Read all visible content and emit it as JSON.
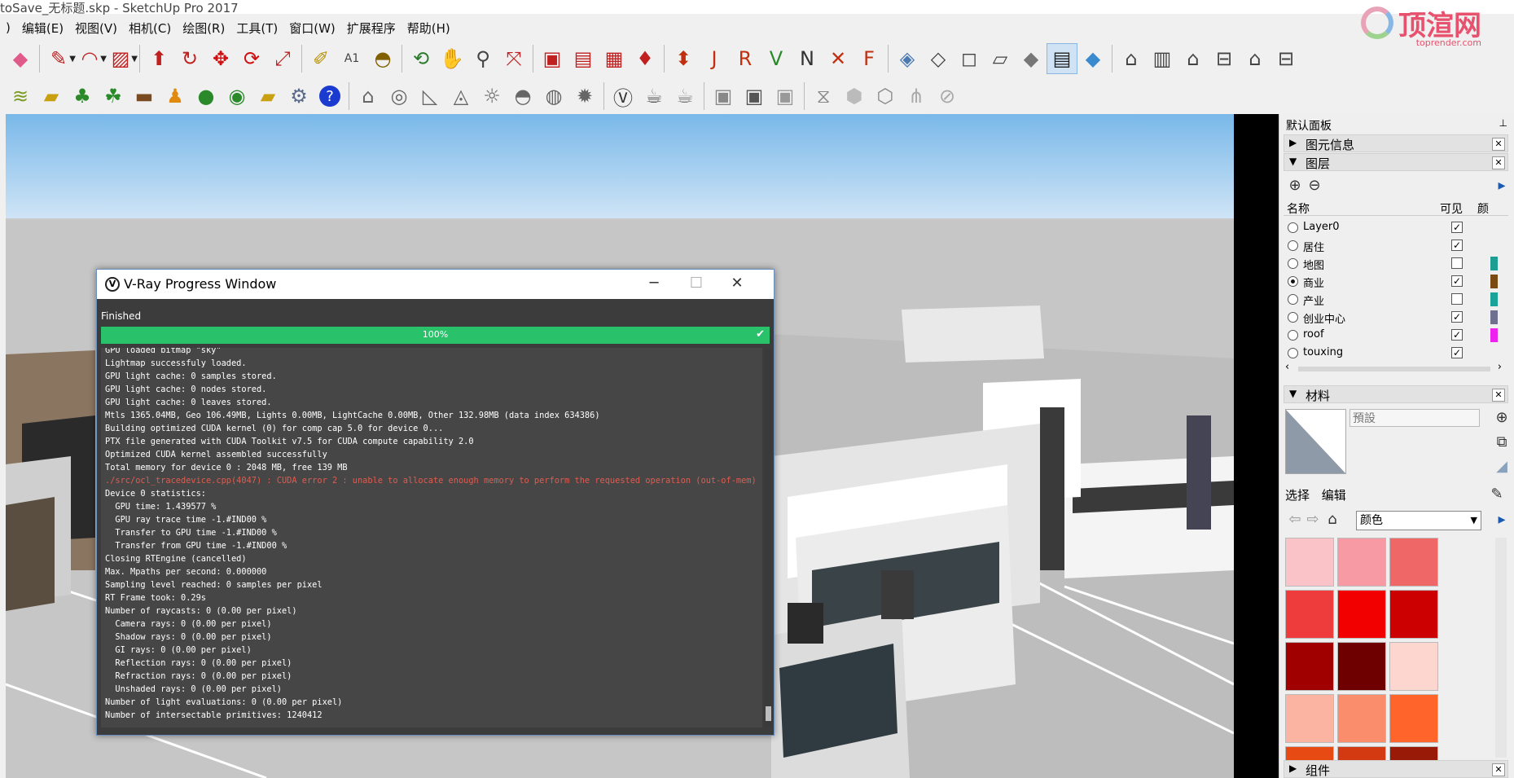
{
  "window": {
    "title": "toSave_无标题.skp - SketchUp Pro 2017"
  },
  "watermark": {
    "text": "顶渲网",
    "sub": "toprender.com"
  },
  "menu": [
    ")",
    "编辑(E)",
    "视图(V)",
    "相机(C)",
    "绘图(R)",
    "工具(T)",
    "窗口(W)",
    "扩展程序",
    "帮助(H)"
  ],
  "vray": {
    "title": "V-Ray Progress Window",
    "status": "Finished",
    "progress_pct": 100,
    "progress_label": "100%",
    "log": [
      "GPU loaded bitmap \"sky\"",
      "Lightmap successfuly loaded.",
      "GPU light cache: 0 samples stored.",
      "GPU light cache: 0 nodes stored.",
      "GPU light cache: 0 leaves stored.",
      "Mtls 1365.04MB, Geo 106.49MB, Lights 0.00MB, LightCache 0.00MB, Other 132.98MB (data index 634386)",
      "Building optimized CUDA kernel (0) for comp cap 5.0 for device 0...",
      "PTX file generated with CUDA Toolkit v7.5 for CUDA compute capability 2.0",
      "Optimized CUDA kernel assembled successfully",
      "Total memory for device 0 : 2048 MB, free 139 MB",
      "./src/ocl_tracedevice.cpp(4047) : CUDA error 2 : unable to allocate enough memory to perform the requested operation (out-of-mem)",
      "Device 0 statistics:",
      "  GPU time: 1.439577 %",
      "  GPU ray trace time -1.#IND00 %",
      "  Transfer to GPU time -1.#IND00 %",
      "  Transfer from GPU time -1.#IND00 %",
      "Closing RTEngine (cancelled)",
      "Max. Mpaths per second: 0.000000",
      "Sampling level reached: 0 samples per pixel",
      "RT Frame took: 0.29s",
      "Number of raycasts: 0 (0.00 per pixel)",
      "  Camera rays: 0 (0.00 per pixel)",
      "  Shadow rays: 0 (0.00 per pixel)",
      "  GI rays: 0 (0.00 per pixel)",
      "  Reflection rays: 0 (0.00 per pixel)",
      "  Refraction rays: 0 (0.00 per pixel)",
      "  Unshaded rays: 0 (0.00 per pixel)",
      "Number of light evaluations: 0 (0.00 per pixel)",
      "Number of intersectable primitives: 1240412"
    ],
    "error_line_index": 10
  },
  "panel": {
    "title": "默认面板",
    "entity_info": "图元信息",
    "layers_title": "图层",
    "col_name": "名称",
    "col_visible": "可见",
    "col_color": "颜",
    "layers": [
      {
        "name": "Layer0",
        "active": false,
        "visible": true,
        "color": ""
      },
      {
        "name": "居住",
        "active": false,
        "visible": true,
        "color": ""
      },
      {
        "name": "地图",
        "active": false,
        "visible": false,
        "color": "#1e9e92"
      },
      {
        "name": "商业",
        "active": true,
        "visible": true,
        "color": "#7a4a12"
      },
      {
        "name": "产业",
        "active": false,
        "visible": false,
        "color": "#1aa398"
      },
      {
        "name": "创业中心",
        "active": false,
        "visible": true,
        "color": "#6f6f8f"
      },
      {
        "name": "roof",
        "active": false,
        "visible": true,
        "color": "#ee22ee"
      },
      {
        "name": "touxing",
        "active": false,
        "visible": true,
        "color": ""
      }
    ],
    "materials_title": "材料",
    "material_name": "預設",
    "tab_select": "选择",
    "tab_edit": "编辑",
    "library": "颜色",
    "swatches": [
      "#f9c3c8",
      "#f79aa3",
      "#f06767",
      "#ee3b3b",
      "#f20000",
      "#cc0000",
      "#a00000",
      "#6e0000",
      "#fdd7cf",
      "#fbb3a2",
      "#fa8d6b",
      "#ff642a",
      "#e84a14",
      "#d33a12",
      "#9a1a08"
    ],
    "components_title": "组件"
  }
}
